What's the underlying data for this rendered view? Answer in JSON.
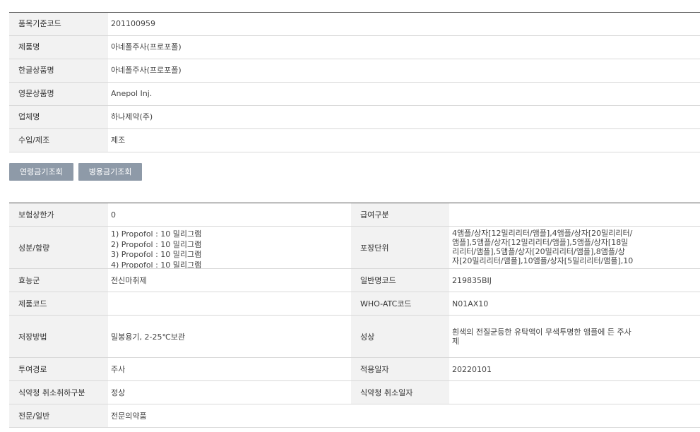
{
  "basic": {
    "rows": [
      {
        "label": "품목기준코드",
        "value": "201100959"
      },
      {
        "label": "제품명",
        "value": "아네폴주사(프로포폴)"
      },
      {
        "label": "한글상품명",
        "value": "아네폴주사(프로포폴)"
      },
      {
        "label": "영문상품명",
        "value": "Anepol Inj."
      },
      {
        "label": "업체명",
        "value": "하나제약(주)"
      },
      {
        "label": "수입/제조",
        "value": "제조"
      }
    ]
  },
  "buttons": {
    "age": "연령금기조회",
    "combo": "병용금기조회"
  },
  "detail": {
    "insurance_label": "보험상한가",
    "insurance_value": "0",
    "benefit_label": "급여구분",
    "benefit_value": "",
    "ingredient_label": "성분/함량",
    "ingredients": [
      "1) Propofol : 10 밀리그램",
      "2) Propofol : 10 밀리그램",
      "3) Propofol : 10 밀리그램",
      "4) Propofol : 10 밀리그램"
    ],
    "pack_label": "포장단위",
    "pack_lines": [
      "4앰플/상자[12밀리리터/앰플],4앰플/상자[20밀리리터/",
      "앰플],5앰플/상자[12밀리리터/앰플],5앰플/상자[18밀",
      "리리터/앰플],5앰플/상자[20밀리리터/앰플],8앰플/상",
      "자[20밀리리터/앰플],10앰플/상자[5밀리리터/앰플],10"
    ],
    "efficacy_label": "효능군",
    "efficacy_value": "전신마취제",
    "generic_label": "일반명코드",
    "generic_value": "219835BIJ",
    "product_code_label": "제품코드",
    "product_code_value": "",
    "atc_label": "WHO-ATC코드",
    "atc_value": "N01AX10",
    "storage_label": "저장방법",
    "storage_value": "밀봉용기, 2-25℃보관",
    "appearance_label": "성상",
    "appearance_lines": [
      "흰색의 전질균등한 유탁액이 무색투명한 앰플에 든 주사",
      "제"
    ],
    "route_label": "투여경로",
    "route_value": "주사",
    "apply_date_label": "적용일자",
    "apply_date_value": "20220101",
    "mfds_cancel_label": "식약청 취소취하구분",
    "mfds_cancel_value": "정상",
    "mfds_cancel_date_label": "식약청 취소일자",
    "mfds_cancel_date_value": "",
    "category_label": "전문/일반",
    "category_value": "전문의약품"
  }
}
